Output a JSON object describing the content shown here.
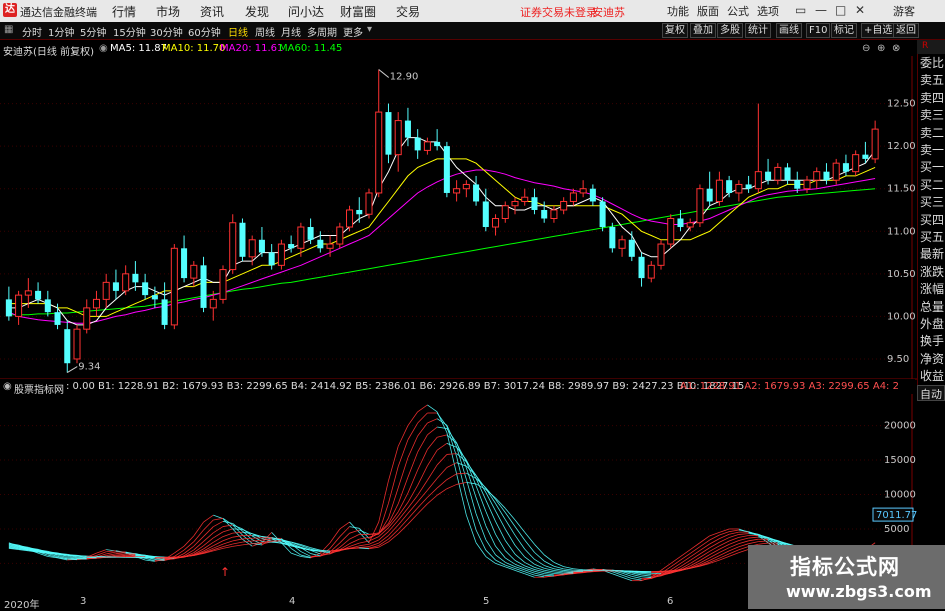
{
  "app": {
    "title": "通达信金融终端",
    "logo": "达"
  },
  "menu": [
    "行情",
    "市场",
    "资讯",
    "发现",
    "问小达",
    "财富圈",
    "交易"
  ],
  "warning": "证券交易未登录",
  "stock_name_top": "安迪苏",
  "toolbar": [
    "功能",
    "版面",
    "公式",
    "选项"
  ],
  "guest": "游客",
  "periods": [
    "分时",
    "1分钟",
    "5分钟",
    "15分钟",
    "30分钟",
    "60分钟",
    "日线",
    "周线",
    "月线",
    "多周期",
    "更多"
  ],
  "active_period": "日线",
  "right_tabs": [
    "复权",
    "叠加",
    "多股",
    "统计",
    "画线",
    "F10",
    "标记",
    "+自选",
    "返回"
  ],
  "info": {
    "title": "安迪苏(日线 前复权)",
    "ma5": "MA5: 11.87",
    "ma10": "MA10: 11.70",
    "ma20": "MA20: 11.61",
    "ma60": "MA60: 11.45"
  },
  "sidebar": [
    "委比",
    "卖五",
    "卖四",
    "卖三",
    "卖二",
    "卖一",
    "买一",
    "买二",
    "买三",
    "买四",
    "买五",
    "最新",
    "涨跌",
    "涨幅",
    "总量",
    "外盘",
    "换手",
    "净资",
    "收益"
  ],
  "sidebar_top": "R",
  "auto_label": "自动",
  "indicator": {
    "name": "股票指标网",
    "values": ": 0.00  B1: 1228.91  B2: 1679.93  B3: 2299.65  B4: 2414.92  B5: 2386.01  B6: 2926.89  B7: 3017.24  B8: 2989.97  B9: 2427.23  B10: 1827.15",
    "a_values": "A1: 1228.91  A2: 1679.93  A3: 2299.65  A4: 2"
  },
  "price_axis": [
    "12.50",
    "12.00",
    "11.50",
    "11.00",
    "10.50",
    "10.00",
    "9.50"
  ],
  "ind_axis": [
    "20000",
    "15000",
    "10000",
    "5000",
    "0"
  ],
  "ind_marker": "7011.77",
  "annot_high": "12.90",
  "annot_low": "9.34",
  "bottom_axis": [
    "2020年",
    "3",
    "4",
    "5",
    "6"
  ],
  "watermark": {
    "line1": "指标公式网",
    "line2": "www.zbgs3.com"
  },
  "colors": {
    "up": "#ff3232",
    "down": "#54ffff",
    "ma5": "#ffffff",
    "ma10": "#ffff00",
    "ma20": "#ff00ff",
    "ma60": "#00ff00"
  },
  "chart_data": {
    "type": "candlestick",
    "candles": [
      [
        10.2,
        10.35,
        9.95,
        10.0
      ],
      [
        10.0,
        10.3,
        9.9,
        10.25
      ],
      [
        10.25,
        10.45,
        10.1,
        10.3
      ],
      [
        10.3,
        10.4,
        10.15,
        10.2
      ],
      [
        10.2,
        10.3,
        10.0,
        10.05
      ],
      [
        10.05,
        10.15,
        9.85,
        9.9
      ],
      [
        9.85,
        9.95,
        9.34,
        9.45
      ],
      [
        9.5,
        9.9,
        9.45,
        9.85
      ],
      [
        9.85,
        10.2,
        9.8,
        10.1
      ],
      [
        10.1,
        10.3,
        10.0,
        10.2
      ],
      [
        10.2,
        10.5,
        10.1,
        10.4
      ],
      [
        10.4,
        10.55,
        10.2,
        10.3
      ],
      [
        10.3,
        10.6,
        10.25,
        10.5
      ],
      [
        10.5,
        10.65,
        10.3,
        10.4
      ],
      [
        10.4,
        10.5,
        10.2,
        10.25
      ],
      [
        10.25,
        10.35,
        10.1,
        10.2
      ],
      [
        10.2,
        10.4,
        9.85,
        9.9
      ],
      [
        9.9,
        10.85,
        9.85,
        10.8
      ],
      [
        10.8,
        10.95,
        10.4,
        10.45
      ],
      [
        10.45,
        10.65,
        10.35,
        10.6
      ],
      [
        10.6,
        10.7,
        10.05,
        10.1
      ],
      [
        10.1,
        10.3,
        9.95,
        10.2
      ],
      [
        10.2,
        10.6,
        10.15,
        10.55
      ],
      [
        10.55,
        11.2,
        10.5,
        11.1
      ],
      [
        11.1,
        11.15,
        10.65,
        10.7
      ],
      [
        10.7,
        10.95,
        10.6,
        10.9
      ],
      [
        10.9,
        11.05,
        10.7,
        10.75
      ],
      [
        10.75,
        10.85,
        10.55,
        10.6
      ],
      [
        10.6,
        10.9,
        10.55,
        10.85
      ],
      [
        10.85,
        10.95,
        10.75,
        10.8
      ],
      [
        10.8,
        11.1,
        10.7,
        11.05
      ],
      [
        11.05,
        11.15,
        10.85,
        10.9
      ],
      [
        10.9,
        11.0,
        10.75,
        10.8
      ],
      [
        10.8,
        10.95,
        10.7,
        10.85
      ],
      [
        10.85,
        11.1,
        10.8,
        11.05
      ],
      [
        11.05,
        11.3,
        11.0,
        11.25
      ],
      [
        11.25,
        11.4,
        11.1,
        11.2
      ],
      [
        11.2,
        11.5,
        11.15,
        11.45
      ],
      [
        11.45,
        12.9,
        11.4,
        12.4
      ],
      [
        12.4,
        12.5,
        11.8,
        11.9
      ],
      [
        11.9,
        12.4,
        11.7,
        12.3
      ],
      [
        12.3,
        12.45,
        12.0,
        12.1
      ],
      [
        12.1,
        12.2,
        11.85,
        11.95
      ],
      [
        11.95,
        12.1,
        11.9,
        12.05
      ],
      [
        12.05,
        12.2,
        11.95,
        12.0
      ],
      [
        12.0,
        12.05,
        11.4,
        11.45
      ],
      [
        11.45,
        11.6,
        11.35,
        11.5
      ],
      [
        11.5,
        11.6,
        11.4,
        11.55
      ],
      [
        11.55,
        11.65,
        11.3,
        11.35
      ],
      [
        11.35,
        11.5,
        11.0,
        11.05
      ],
      [
        11.05,
        11.2,
        10.95,
        11.15
      ],
      [
        11.15,
        11.35,
        11.1,
        11.3
      ],
      [
        11.3,
        11.4,
        11.2,
        11.35
      ],
      [
        11.35,
        11.5,
        11.3,
        11.4
      ],
      [
        11.4,
        11.5,
        11.2,
        11.25
      ],
      [
        11.25,
        11.35,
        11.1,
        11.15
      ],
      [
        11.15,
        11.3,
        11.1,
        11.25
      ],
      [
        11.25,
        11.4,
        11.2,
        11.35
      ],
      [
        11.35,
        11.5,
        11.3,
        11.45
      ],
      [
        11.45,
        11.6,
        11.4,
        11.5
      ],
      [
        11.5,
        11.55,
        11.3,
        11.35
      ],
      [
        11.35,
        11.4,
        11.0,
        11.05
      ],
      [
        11.05,
        11.1,
        10.75,
        10.8
      ],
      [
        10.8,
        10.95,
        10.7,
        10.9
      ],
      [
        10.9,
        11.0,
        10.65,
        10.7
      ],
      [
        10.7,
        10.75,
        10.35,
        10.45
      ],
      [
        10.45,
        10.65,
        10.4,
        10.6
      ],
      [
        10.6,
        10.9,
        10.55,
        10.85
      ],
      [
        10.85,
        11.2,
        10.8,
        11.15
      ],
      [
        11.15,
        11.25,
        11.0,
        11.05
      ],
      [
        11.05,
        11.15,
        11.0,
        11.1
      ],
      [
        11.1,
        11.55,
        11.05,
        11.5
      ],
      [
        11.5,
        11.7,
        11.3,
        11.35
      ],
      [
        11.35,
        11.7,
        11.3,
        11.6
      ],
      [
        11.6,
        11.65,
        11.4,
        11.45
      ],
      [
        11.45,
        11.6,
        11.35,
        11.55
      ],
      [
        11.55,
        11.65,
        11.45,
        11.5
      ],
      [
        11.5,
        12.5,
        11.45,
        11.7
      ],
      [
        11.7,
        11.85,
        11.55,
        11.6
      ],
      [
        11.6,
        11.8,
        11.55,
        11.75
      ],
      [
        11.75,
        11.8,
        11.55,
        11.6
      ],
      [
        11.6,
        11.7,
        11.45,
        11.5
      ],
      [
        11.5,
        11.65,
        11.45,
        11.6
      ],
      [
        11.6,
        11.75,
        11.5,
        11.7
      ],
      [
        11.7,
        11.8,
        11.55,
        11.6
      ],
      [
        11.6,
        11.85,
        11.55,
        11.8
      ],
      [
        11.8,
        11.9,
        11.65,
        11.7
      ],
      [
        11.7,
        11.95,
        11.65,
        11.9
      ],
      [
        11.9,
        12.05,
        11.8,
        11.85
      ],
      [
        11.85,
        12.3,
        11.8,
        12.2
      ]
    ],
    "ma5": [
      10.1,
      10.1,
      10.15,
      10.2,
      10.15,
      10.1,
      9.95,
      9.9,
      9.9,
      9.95,
      10.1,
      10.2,
      10.3,
      10.35,
      10.35,
      10.3,
      10.25,
      10.3,
      10.35,
      10.4,
      10.45,
      10.4,
      10.4,
      10.6,
      10.65,
      10.65,
      10.75,
      10.75,
      10.75,
      10.8,
      10.85,
      10.9,
      10.95,
      10.95,
      10.95,
      11.05,
      11.15,
      11.2,
      11.5,
      11.7,
      11.95,
      12.1,
      12.1,
      12.05,
      12.05,
      11.9,
      11.75,
      11.65,
      11.55,
      11.4,
      11.3,
      11.3,
      11.25,
      11.25,
      11.3,
      11.3,
      11.25,
      11.3,
      11.3,
      11.35,
      11.4,
      11.35,
      11.2,
      11.05,
      10.95,
      10.75,
      10.7,
      10.7,
      10.8,
      10.9,
      11.05,
      11.15,
      11.3,
      11.35,
      11.45,
      11.5,
      11.5,
      11.55,
      11.6,
      11.6,
      11.6,
      11.6,
      11.6,
      11.6,
      11.6,
      11.65,
      11.7,
      11.75,
      11.8,
      11.95
    ],
    "ma10": [
      10.15,
      10.15,
      10.15,
      10.15,
      10.15,
      10.1,
      10.1,
      10.05,
      10.0,
      10.0,
      10.0,
      10.05,
      10.1,
      10.15,
      10.2,
      10.25,
      10.3,
      10.3,
      10.35,
      10.35,
      10.4,
      10.4,
      10.4,
      10.45,
      10.5,
      10.55,
      10.6,
      10.6,
      10.65,
      10.7,
      10.75,
      10.8,
      10.85,
      10.85,
      10.9,
      10.95,
      11.0,
      11.05,
      11.2,
      11.35,
      11.5,
      11.65,
      11.75,
      11.8,
      11.85,
      11.85,
      11.85,
      11.85,
      11.8,
      11.7,
      11.6,
      11.5,
      11.4,
      11.35,
      11.35,
      11.3,
      11.3,
      11.3,
      11.3,
      11.3,
      11.3,
      11.3,
      11.25,
      11.2,
      11.1,
      11.0,
      10.95,
      10.9,
      10.9,
      10.9,
      10.9,
      10.95,
      11.0,
      11.1,
      11.2,
      11.3,
      11.4,
      11.45,
      11.5,
      11.5,
      11.55,
      11.55,
      11.55,
      11.6,
      11.6,
      11.6,
      11.65,
      11.65,
      11.7,
      11.75
    ],
    "ma20": [
      10.05,
      10.0,
      9.98,
      9.96,
      9.95,
      9.94,
      9.93,
      9.92,
      9.92,
      9.94,
      9.97,
      10.0,
      10.02,
      10.05,
      10.07,
      10.1,
      10.12,
      10.15,
      10.17,
      10.2,
      10.22,
      10.25,
      10.28,
      10.32,
      10.36,
      10.4,
      10.44,
      10.48,
      10.52,
      10.56,
      10.6,
      10.65,
      10.7,
      10.75,
      10.8,
      10.85,
      10.9,
      10.95,
      11.05,
      11.15,
      11.25,
      11.35,
      11.45,
      11.52,
      11.58,
      11.63,
      11.67,
      11.7,
      11.72,
      11.72,
      11.7,
      11.67,
      11.63,
      11.6,
      11.57,
      11.55,
      11.53,
      11.5,
      11.48,
      11.46,
      11.43,
      11.38,
      11.32,
      11.26,
      11.2,
      11.15,
      11.12,
      11.1,
      11.08,
      11.08,
      11.1,
      11.12,
      11.15,
      11.2,
      11.25,
      11.3,
      11.35,
      11.4,
      11.43,
      11.45,
      11.47,
      11.48,
      11.49,
      11.5,
      11.52,
      11.54,
      11.56,
      11.58,
      11.6,
      11.62
    ],
    "ma60": [
      10.02,
      10.02,
      10.02,
      10.03,
      10.03,
      10.04,
      10.04,
      10.05,
      10.06,
      10.07,
      10.08,
      10.09,
      10.1,
      10.11,
      10.12,
      10.14,
      10.16,
      10.18,
      10.2,
      10.22,
      10.24,
      10.26,
      10.28,
      10.3,
      10.32,
      10.33,
      10.35,
      10.37,
      10.39,
      10.4,
      10.42,
      10.44,
      10.46,
      10.48,
      10.5,
      10.52,
      10.54,
      10.56,
      10.58,
      10.6,
      10.62,
      10.64,
      10.66,
      10.68,
      10.7,
      10.72,
      10.74,
      10.76,
      10.78,
      10.8,
      10.82,
      10.84,
      10.86,
      10.88,
      10.9,
      10.92,
      10.94,
      10.96,
      10.98,
      11.0,
      11.02,
      11.04,
      11.06,
      11.08,
      11.1,
      11.12,
      11.14,
      11.16,
      11.18,
      11.2,
      11.22,
      11.24,
      11.26,
      11.28,
      11.3,
      11.32,
      11.34,
      11.36,
      11.38,
      11.4,
      11.41,
      11.42,
      11.43,
      11.44,
      11.45,
      11.46,
      11.47,
      11.48,
      11.49,
      11.5
    ],
    "ind_series": [
      3000,
      2500,
      2000,
      1500,
      1000,
      800,
      500,
      600,
      900,
      1500,
      2000,
      1800,
      1500,
      1000,
      500,
      300,
      600,
      1500,
      2500,
      4000,
      6000,
      7000,
      6500,
      5000,
      3500,
      2500,
      3000,
      4500,
      3000,
      1500,
      1000,
      800,
      1500,
      3000,
      5000,
      6000,
      4500,
      3000,
      6000,
      12000,
      17000,
      20000,
      22000,
      23000,
      22000,
      19000,
      13000,
      7000,
      3000,
      1000,
      0,
      -500,
      -1000,
      -1500,
      -2000,
      -2000,
      -1800,
      -1500,
      -1200,
      -1000,
      -800,
      -1000,
      -1500,
      -2000,
      -2500,
      -2500,
      -2000,
      -1000,
      0,
      1000,
      2000,
      3000,
      4000,
      4500,
      5000,
      5000,
      4500,
      4000,
      3000,
      2000,
      1000,
      500,
      0,
      -500,
      -500,
      0,
      500,
      1000,
      2000,
      3000
    ],
    "ylim": [
      9.3,
      13.0
    ],
    "ind_ylim": [
      -4000,
      24000
    ]
  }
}
